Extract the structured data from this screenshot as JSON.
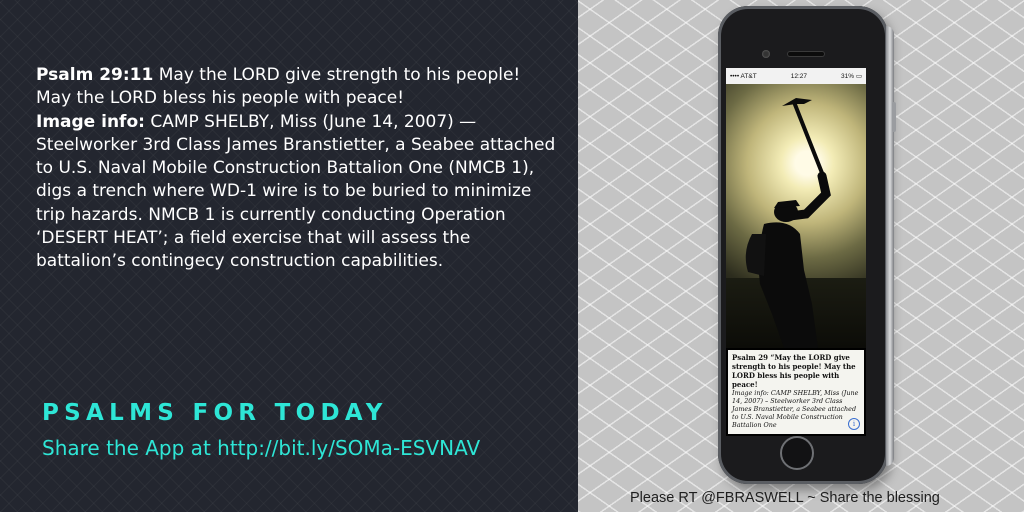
{
  "verse": {
    "ref_label": "Psalm 29:11",
    "text": " May the LORD give strength to his people! May the LORD bless his people with peace!",
    "info_label": "Image info:",
    "info_text": " CAMP SHELBY, Miss (June 14, 2007) — Steelworker 3rd Class James Branstietter, a Seabee attached to U.S. Naval Mobile Construction Battalion One (NMCB 1), digs a trench where WD-1 wire is to be buried to minimize trip hazards. NMCB 1 is currently conducting Operation ‘DESERT HEAT’; a field exercise that will assess the battalion’s contingecy construction capabilities."
  },
  "brand": "PSALMS FOR TODAY",
  "share": "Share the App at  http://bit.ly/SOMa-ESVNAV",
  "footer": "Please RT @FBRASWELL ~ Share the blessing",
  "phone": {
    "carrier": "•••• AT&T",
    "time": "12:27",
    "battery": "31% ▭",
    "caption_title": "Psalm 29  “May the LORD give strength to his people! May the LORD bless his people with peace!",
    "caption_info": "Image info: CAMP SHELBY, Miss (June 14, 2007) – Steelworker 3rd Class James Branstietter, a Seabee attached to U.S. Naval Mobile Construction Battalion One",
    "info_icon": "i"
  },
  "colors": {
    "accent": "#2ee6d6",
    "left_bg": "#23262f",
    "right_bg": "#c4c4c4"
  }
}
